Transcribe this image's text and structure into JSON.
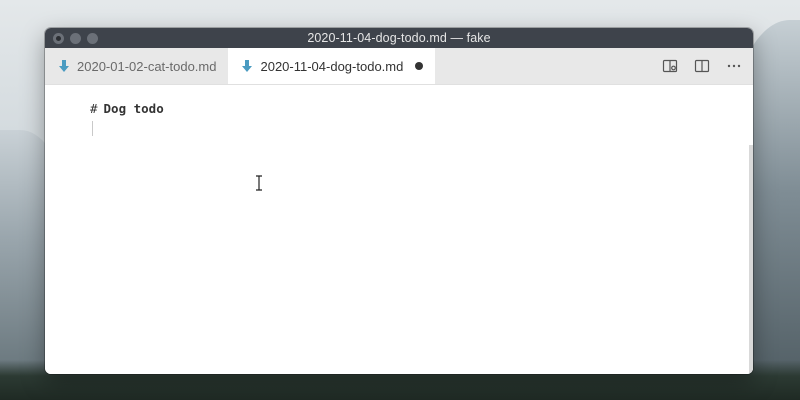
{
  "window": {
    "title": "2020-11-04-dog-todo.md — fake"
  },
  "tabs": [
    {
      "label": "2020-01-02-cat-todo.md",
      "icon": "markdown-file-icon",
      "active": false,
      "dirty": false
    },
    {
      "label": "2020-11-04-dog-todo.md",
      "icon": "markdown-file-icon",
      "active": true,
      "dirty": true
    }
  ],
  "editor": {
    "line1_hash": "#",
    "line1_text": "Dog todo"
  },
  "colors": {
    "titlebar": "#3e434b",
    "tabbar": "#e8e8e8",
    "file_icon": "#4a9bc1"
  }
}
